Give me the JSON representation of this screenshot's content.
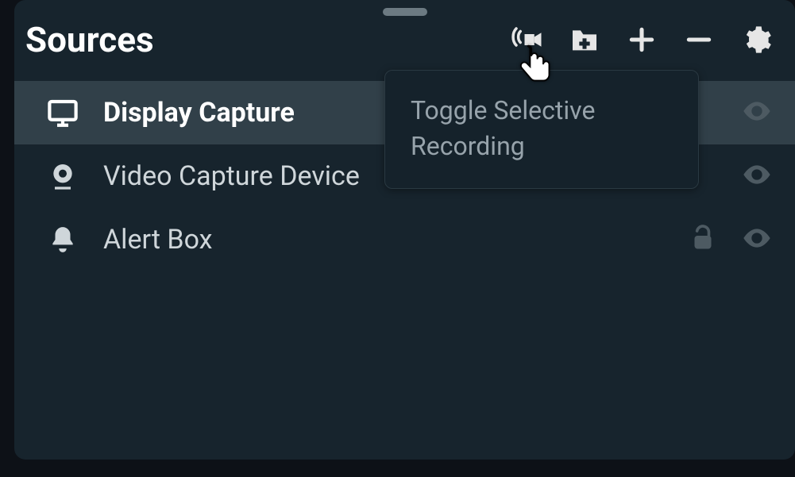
{
  "panel": {
    "title": "Sources"
  },
  "toolbar": {
    "selective_recording": "Toggle Selective Recording",
    "add_folder": "Add Folder",
    "add_source": "Add Source",
    "remove_source": "Remove Source",
    "settings": "Settings"
  },
  "tooltip": {
    "text": "Toggle Selective Recording"
  },
  "sources": [
    {
      "icon": "monitor",
      "label": "Display Capture",
      "selected": true,
      "lock": false
    },
    {
      "icon": "webcam",
      "label": "Video Capture Device",
      "selected": false,
      "lock": false
    },
    {
      "icon": "bell",
      "label": "Alert Box",
      "selected": false,
      "lock": true
    }
  ]
}
